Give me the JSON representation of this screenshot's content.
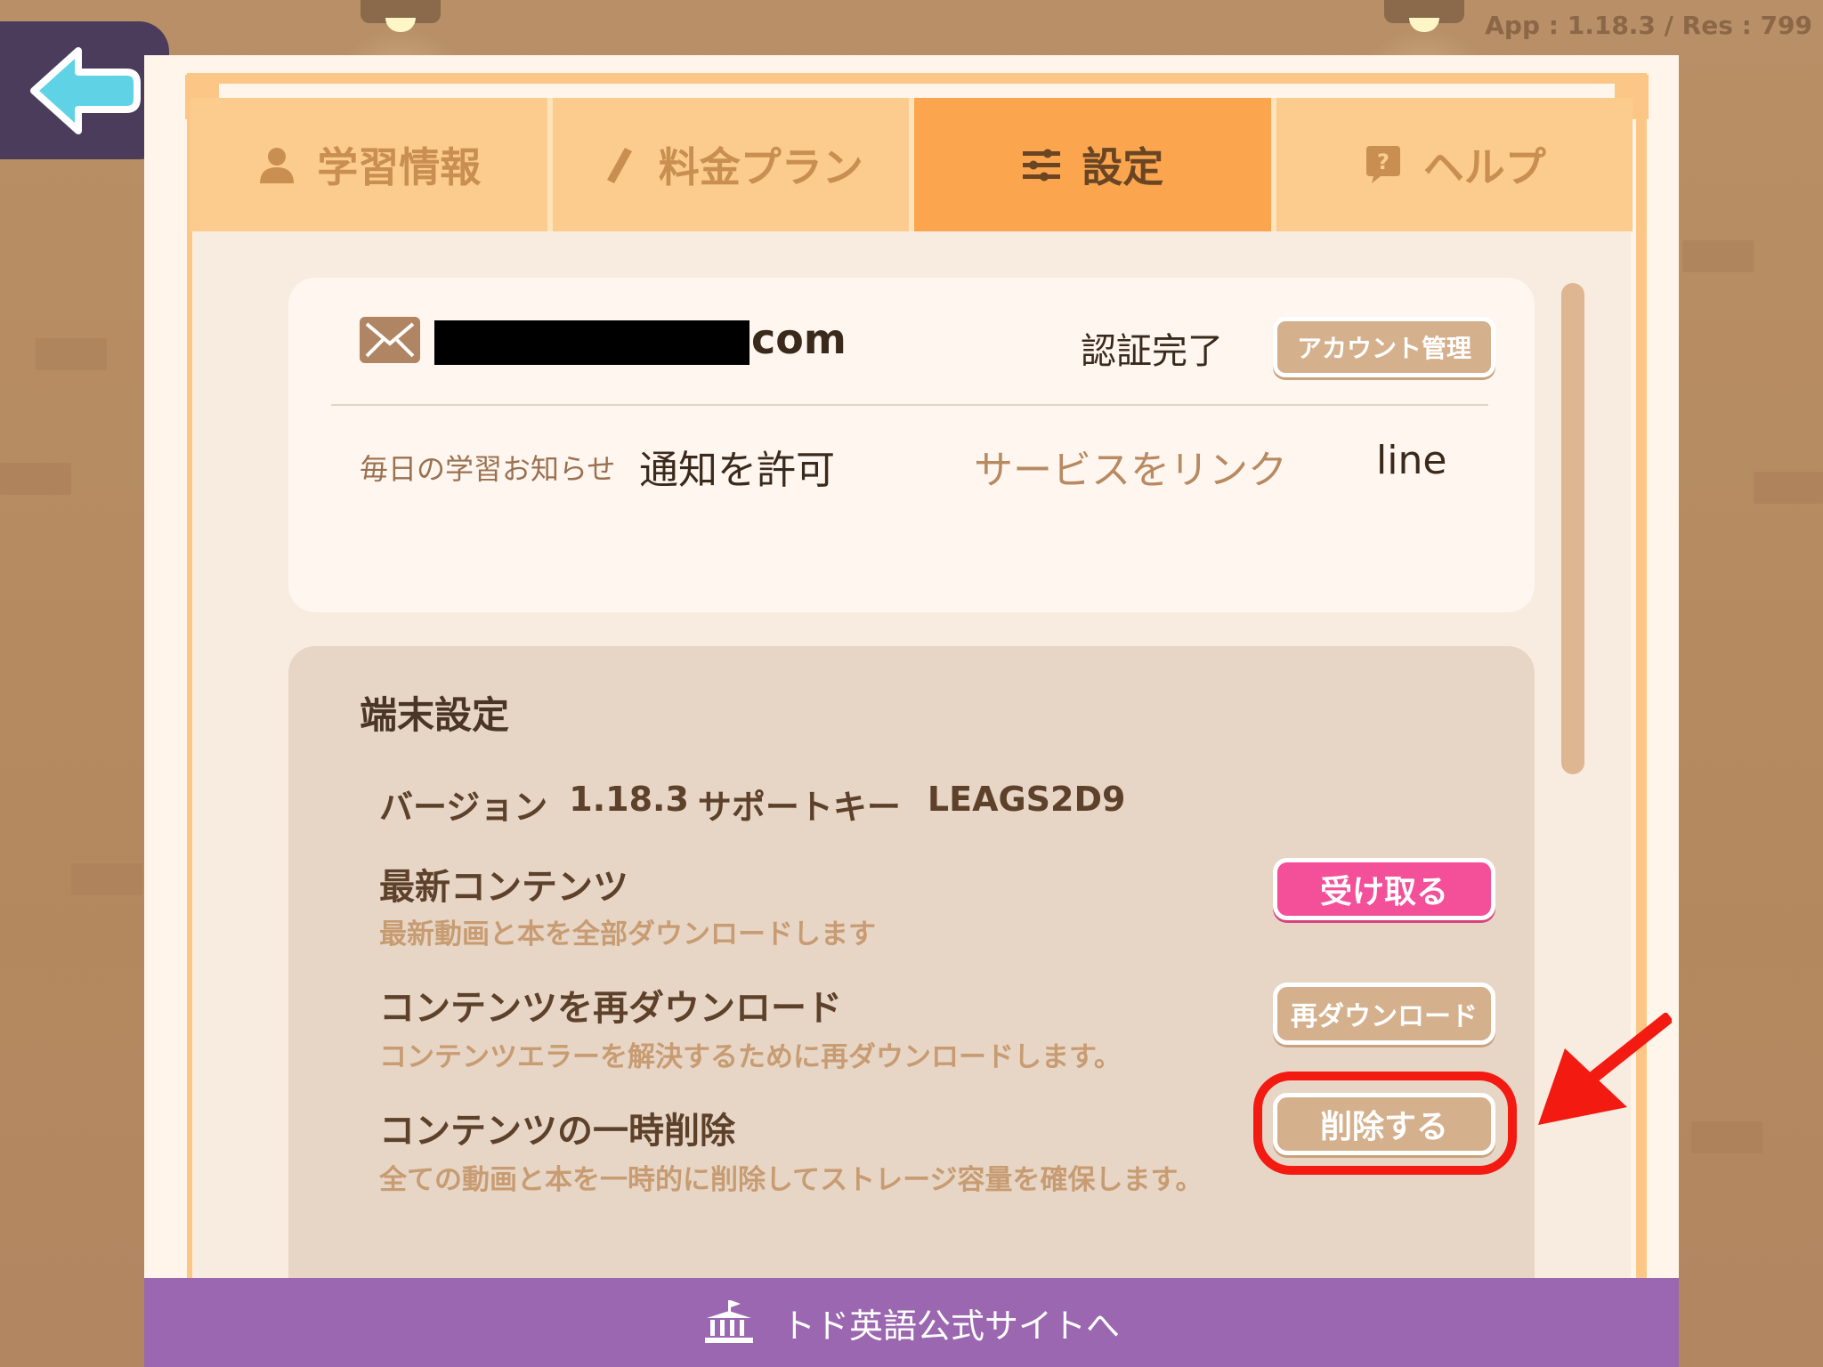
{
  "overlay": {
    "version_text": "App : 1.18.3 / Res : 799"
  },
  "tabs": [
    {
      "label": "学習情報",
      "icon": "person-icon",
      "active": false
    },
    {
      "label": "料金プラン",
      "icon": "pencil-icon",
      "active": false
    },
    {
      "label": "設定",
      "icon": "sliders-icon",
      "active": true
    },
    {
      "label": "ヘルプ",
      "icon": "question-icon",
      "active": false
    }
  ],
  "account": {
    "email_suffix": "com",
    "verified_label": "認証完了",
    "manage_button": "アカウント管理",
    "notification_label": "毎日の学習お知らせ",
    "notification_value": "通知を許可",
    "link_label": "サービスをリンク",
    "link_value": "line"
  },
  "device": {
    "title": "端末設定",
    "version_label": "バージョン",
    "version_value": "1.18.3",
    "support_key_label": "サポートキー",
    "support_key_value": "LEAGS2D9",
    "latest": {
      "title": "最新コンテンツ",
      "desc": "最新動画と本を全部ダウンロードします",
      "button": "受け取る"
    },
    "redownload": {
      "title": "コンテンツを再ダウンロード",
      "desc": "コンテンツエラーを解決するために再ダウンロードします。",
      "button": "再ダウンロード"
    },
    "delete": {
      "title": "コンテンツの一時削除",
      "desc": "全ての動画と本を一時的に削除してストレージ容量を確保します。",
      "button": "削除する"
    }
  },
  "footer": {
    "link_label": "トド英語公式サイトへ"
  },
  "colors": {
    "active_tab": "#fba64f",
    "receive_button": "#f4509a",
    "footer": "#9b67b0",
    "highlight": "#f31a12"
  }
}
